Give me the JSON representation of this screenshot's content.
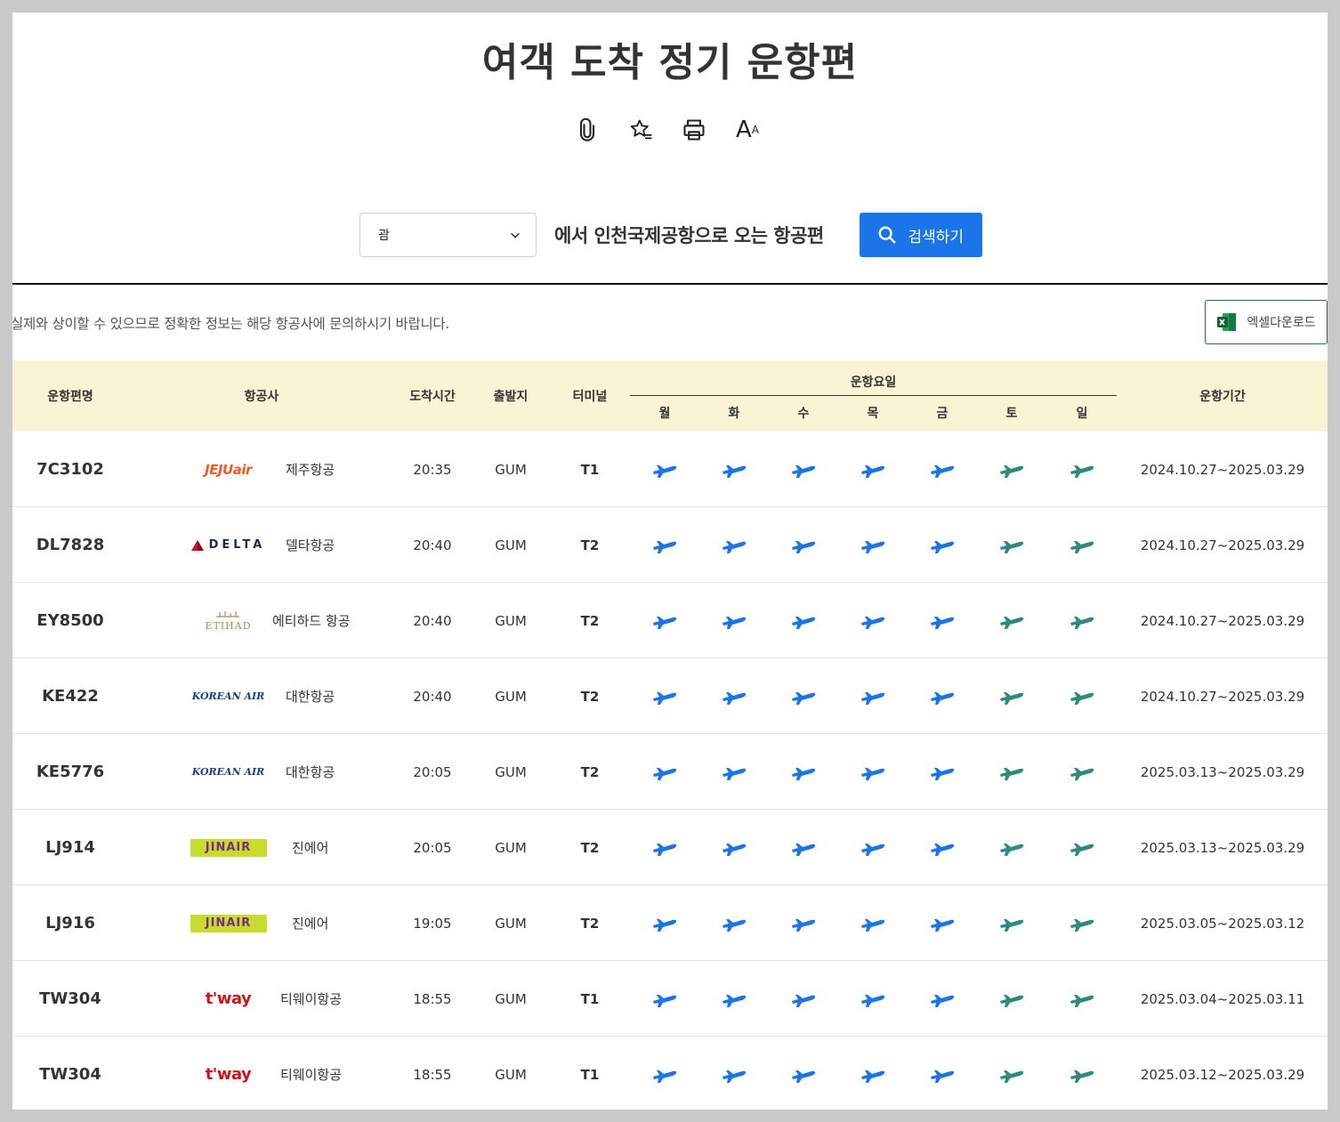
{
  "page": {
    "title": "여객 도착 정기 운항편",
    "tools": [
      {
        "icon": "paperclip-icon"
      },
      {
        "icon": "star-bookmark-icon"
      },
      {
        "icon": "printer-icon"
      },
      {
        "icon": "font-size-icon",
        "label": "A",
        "label_small": "A"
      }
    ]
  },
  "search": {
    "select_value": "괌",
    "suffix_text": "에서 인천국제공항으로 오는 항공편",
    "button_label": "검색하기"
  },
  "notice": "실제와 상이할 수 있으므로 정확한 정보는 해당 항공사에 문의하시기 바랍니다.",
  "excel_button_label": "엑셀다운로드",
  "colors": {
    "accent": "#1b74e8",
    "weekday_plane": "#1b74e8",
    "weekend_plane": "#2e8a7a",
    "header_bg": "#faf3d4"
  },
  "table": {
    "headers": {
      "flight": "운항편명",
      "airline": "항공사",
      "arrival_time": "도착시간",
      "origin": "출발지",
      "terminal": "터미널",
      "days_title": "운항요일",
      "days": [
        "월",
        "화",
        "수",
        "목",
        "금",
        "토",
        "일"
      ],
      "period": "운항기간"
    },
    "rows": [
      {
        "flight": "7C3102",
        "logo": "jeju",
        "logo_text": "JEJUair",
        "airline": "제주항공",
        "time": "20:35",
        "origin": "GUM",
        "terminal": "T1",
        "period": "2024.10.27~2025.03.29"
      },
      {
        "flight": "DL7828",
        "logo": "delta",
        "logo_text": "DELTA",
        "airline": "델타항공",
        "time": "20:40",
        "origin": "GUM",
        "terminal": "T2",
        "period": "2024.10.27~2025.03.29"
      },
      {
        "flight": "EY8500",
        "logo": "etihad",
        "logo_text": "ETIHAD",
        "airline": "에티하드 항공",
        "time": "20:40",
        "origin": "GUM",
        "terminal": "T2",
        "period": "2024.10.27~2025.03.29"
      },
      {
        "flight": "KE422",
        "logo": "korean",
        "logo_text": "KOREAN AIR",
        "airline": "대한항공",
        "time": "20:40",
        "origin": "GUM",
        "terminal": "T2",
        "period": "2024.10.27~2025.03.29"
      },
      {
        "flight": "KE5776",
        "logo": "korean",
        "logo_text": "KOREAN AIR",
        "airline": "대한항공",
        "time": "20:05",
        "origin": "GUM",
        "terminal": "T2",
        "period": "2025.03.13~2025.03.29"
      },
      {
        "flight": "LJ914",
        "logo": "jin",
        "logo_text": "JINAIR",
        "airline": "진에어",
        "time": "20:05",
        "origin": "GUM",
        "terminal": "T2",
        "period": "2025.03.13~2025.03.29"
      },
      {
        "flight": "LJ916",
        "logo": "jin",
        "logo_text": "JINAIR",
        "airline": "진에어",
        "time": "19:05",
        "origin": "GUM",
        "terminal": "T2",
        "period": "2025.03.05~2025.03.12"
      },
      {
        "flight": "TW304",
        "logo": "tway",
        "logo_text": "t'way",
        "airline": "티웨이항공",
        "time": "18:55",
        "origin": "GUM",
        "terminal": "T1",
        "period": "2025.03.04~2025.03.11"
      },
      {
        "flight": "TW304",
        "logo": "tway",
        "logo_text": "t'way",
        "airline": "티웨이항공",
        "time": "18:55",
        "origin": "GUM",
        "terminal": "T1",
        "period": "2025.03.12~2025.03.29"
      }
    ]
  }
}
